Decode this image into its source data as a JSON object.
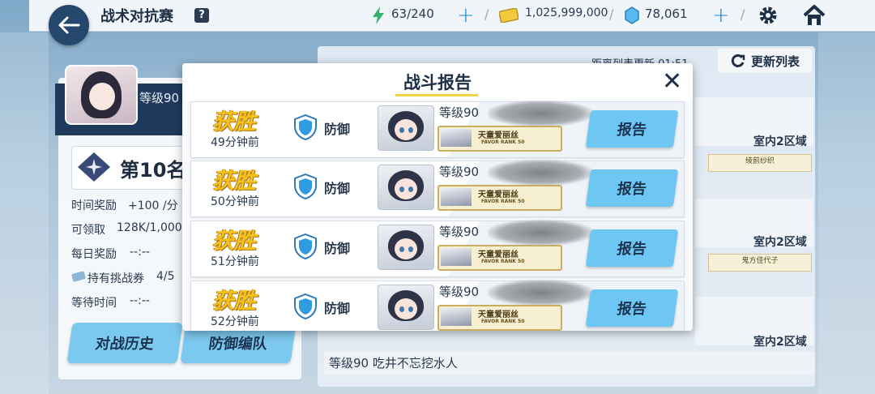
{
  "header": {
    "title": "战术对抗赛",
    "help_label": "?",
    "ap": "63/240",
    "credits": "1,025,999,000",
    "gems": "78,061"
  },
  "left_panel": {
    "level_label": "等级90",
    "rank": "第10名",
    "time_reward_label": "时间奖励",
    "time_reward_value": "+100 /分",
    "claimable_label": "可领取",
    "claimable_value": "128K/1,000",
    "daily_reward_label": "每日奖励",
    "daily_reward_value": "--:--",
    "tickets_label": "持有挑战券",
    "tickets_value": "4/5",
    "wait_label": "等待时间",
    "wait_value": "--:--",
    "history_button": "对战历史",
    "defense_button": "防御编队"
  },
  "right_panel": {
    "refresh_timer": "距离列表更新 01:51",
    "refresh_button": "更新列表",
    "zone_labels": [
      "室内2区域",
      "室内2区域",
      "室内2区域"
    ],
    "opponent_names": [
      "绫前纱织",
      "鬼方佳代子"
    ],
    "bottom_entry": "等级90  吃井不忘挖水人"
  },
  "modal": {
    "title": "战斗报告",
    "close_icon": "close-icon",
    "rows": [
      {
        "result": "获胜",
        "time_ago": "49分钟前",
        "mode": "防御",
        "level": "等级90",
        "tag_name": "天童爱丽丝",
        "tag_rank": "FAVOR RANK 50",
        "button": "报告"
      },
      {
        "result": "获胜",
        "time_ago": "50分钟前",
        "mode": "防御",
        "level": "等级90",
        "tag_name": "天童爱丽丝",
        "tag_rank": "FAVOR RANK 50",
        "button": "报告"
      },
      {
        "result": "获胜",
        "time_ago": "51分钟前",
        "mode": "防御",
        "level": "等级90",
        "tag_name": "天童爱丽丝",
        "tag_rank": "FAVOR RANK 50",
        "button": "报告"
      },
      {
        "result": "获胜",
        "time_ago": "52分钟前",
        "mode": "防御",
        "level": "等级90",
        "tag_name": "天童爱丽丝",
        "tag_rank": "FAVOR RANK 50",
        "button": "报告"
      }
    ]
  },
  "colors": {
    "accent_blue": "#6ec6f2",
    "win_gold": "#f5c21c",
    "navy": "#24476b"
  }
}
